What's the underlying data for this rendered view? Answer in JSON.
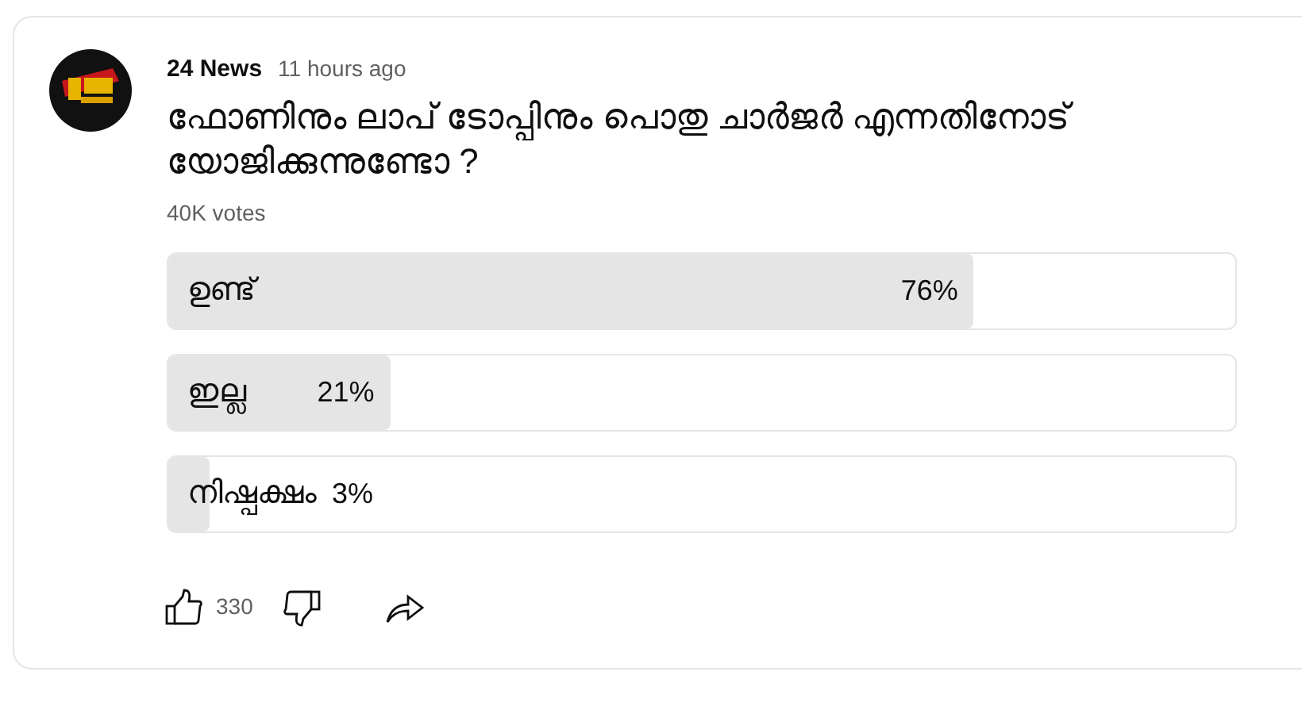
{
  "post": {
    "author": "24 News",
    "time": "11 hours ago",
    "question": "ഫോണിനും ലാപ് ടോപ്പിനും പൊതു ചാർജർ എന്നതിനോട് യോജിക്കുന്നുണ്ടോ ?",
    "votes": "40K votes"
  },
  "options": [
    {
      "label": "ഉണ്ട്",
      "percent": "76%",
      "level": 0.755
    },
    {
      "label": "ഇല്ല",
      "percent": "21%",
      "level": 0.208
    },
    {
      "label": "നിഷ്പക്ഷം",
      "percent": "3%",
      "level": 0.038
    }
  ],
  "actions": {
    "likes": "330"
  }
}
